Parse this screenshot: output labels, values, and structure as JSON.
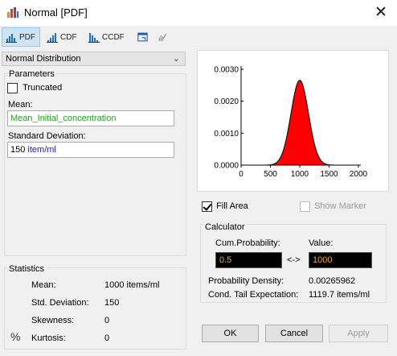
{
  "window": {
    "title": "Normal [PDF]"
  },
  "toolbar": {
    "pdf_label": "PDF",
    "cdf_label": "CDF",
    "ccdf_label": "CCDF"
  },
  "distribution": {
    "selected": "Normal Distribution"
  },
  "parameters": {
    "group_label": "Parameters",
    "truncated_label": "Truncated",
    "truncated_checked": false,
    "mean_label": "Mean:",
    "mean_value": "Mean_Initial_concentration",
    "std_label": "Standard Deviation:",
    "std_number": "150",
    "std_unit": "item/ml"
  },
  "statistics": {
    "group_label": "Statistics",
    "rows": [
      {
        "label": "Mean:",
        "value": "1000 items/ml"
      },
      {
        "label": "Std. Deviation:",
        "value": "150"
      },
      {
        "label": "Skewness:",
        "value": "0"
      },
      {
        "label": "Kurtosis:",
        "value": "0"
      }
    ],
    "percent_symbol": "%"
  },
  "chart_options": {
    "fill_area_label": "Fill Area",
    "fill_area_checked": true,
    "show_marker_label": "Show Marker",
    "show_marker_checked": false
  },
  "calculator": {
    "group_label": "Calculator",
    "cum_prob_label": "Cum.Probability:",
    "value_label": "Value:",
    "cum_prob_value": "0.5",
    "arrow": "<->",
    "value_value": "1000",
    "prob_density_label": "Probability Density:",
    "prob_density_value": "0.00265962",
    "tail_label": "Cond. Tail Expectation:",
    "tail_value": "1119.7 items/ml"
  },
  "buttons": {
    "ok": "OK",
    "cancel": "Cancel",
    "apply": "Apply"
  },
  "colors": {
    "fill": "#ff0000",
    "input_text": "#e8a33b",
    "mean_text": "#22a022",
    "unit_text": "#1a1acc",
    "accent": "#1a6fc9"
  },
  "chart_data": {
    "type": "area",
    "distribution": "normal",
    "mean": 1000,
    "std": 150,
    "xlim": [
      0,
      2000
    ],
    "ylim": [
      0,
      0.003
    ],
    "x_ticks": [
      "0",
      "500",
      "1000",
      "1500",
      "2000"
    ],
    "y_ticks": [
      "0.0000",
      "0.0010",
      "0.0020",
      "0.0030"
    ],
    "fill": true
  }
}
